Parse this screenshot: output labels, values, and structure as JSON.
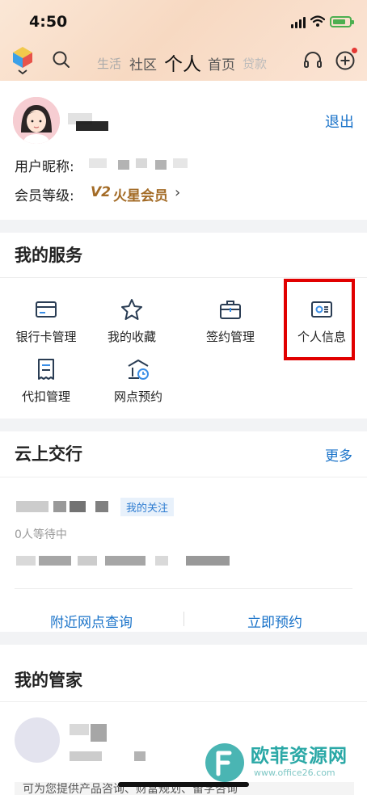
{
  "status_bar": {
    "time": "4:50"
  },
  "nav": {
    "tabs": [
      "生活",
      "社区",
      "个人",
      "首页",
      "贷款"
    ],
    "active_tab": "个人"
  },
  "profile": {
    "logout_label": "退出",
    "nickname_label": "用户昵称:",
    "member_level_label": "会员等级:",
    "member_level_badge": "V2",
    "member_level_name": "火星会员",
    "chevron": "›"
  },
  "services": {
    "title": "我的服务",
    "items": [
      {
        "label": "银行卡管理",
        "icon": "bank-card-icon"
      },
      {
        "label": "我的收藏",
        "icon": "star-icon"
      },
      {
        "label": "签约管理",
        "icon": "briefcase-icon"
      },
      {
        "label": "个人信息",
        "icon": "id-card-icon"
      },
      {
        "label": "代扣管理",
        "icon": "bill-icon"
      },
      {
        "label": "网点预约",
        "icon": "branch-clock-icon"
      }
    ],
    "highlight_color": "#e10000"
  },
  "cloud_branch": {
    "title": "云上交行",
    "more_label": "更多",
    "tag": "我的关注",
    "waiting": "0人等待中",
    "actions": [
      "附近网点查询",
      "立即预约"
    ]
  },
  "butler": {
    "title": "我的管家",
    "description": "可为您提供产品咨询、财富规划、留学咨询"
  },
  "watermark": {
    "text": "欧菲资源网",
    "url": "www.office26.com"
  },
  "colors": {
    "accent": "#1a73c9",
    "gold": "#a36b26"
  }
}
